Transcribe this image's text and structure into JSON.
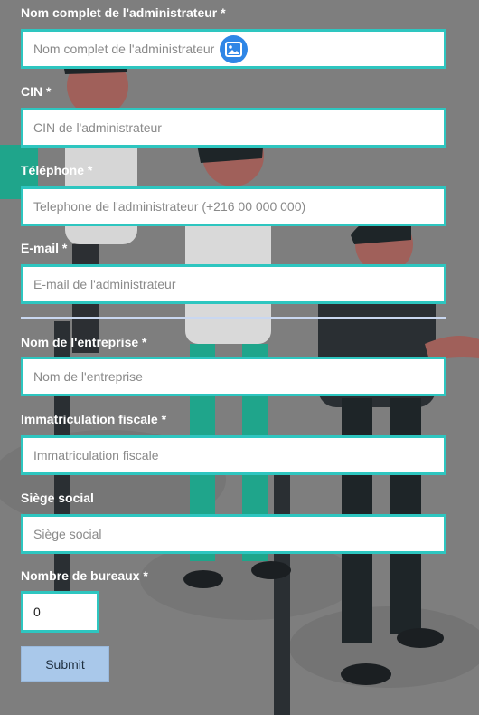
{
  "form": {
    "fields": [
      {
        "label": "Nom complet de l'administrateur *",
        "placeholder": "Nom complet de l'administrateur",
        "value": ""
      },
      {
        "label": "CIN *",
        "placeholder": "CIN de l'administrateur",
        "value": ""
      },
      {
        "label": "Téléphone *",
        "placeholder": "Telephone de l'administrateur (+216 00 000 000)",
        "value": ""
      },
      {
        "label": "E-mail *",
        "placeholder": "E-mail de l'administrateur",
        "value": ""
      },
      {
        "label": "Nom de l'entreprise *",
        "placeholder": "Nom de l'entreprise",
        "value": ""
      },
      {
        "label": "Immatriculation fiscale *",
        "placeholder": "Immatriculation fiscale",
        "value": ""
      },
      {
        "label": "Siège social",
        "placeholder": "Siège social",
        "value": ""
      }
    ],
    "offices": {
      "label": "Nombre de bureaux *",
      "value": "0"
    },
    "submit_label": "Submit"
  },
  "icons": {
    "overlay": "image-icon"
  },
  "colors": {
    "field_border": "#2ec6c0",
    "button": "#a9c8ea",
    "icon": "#2f86e6"
  }
}
